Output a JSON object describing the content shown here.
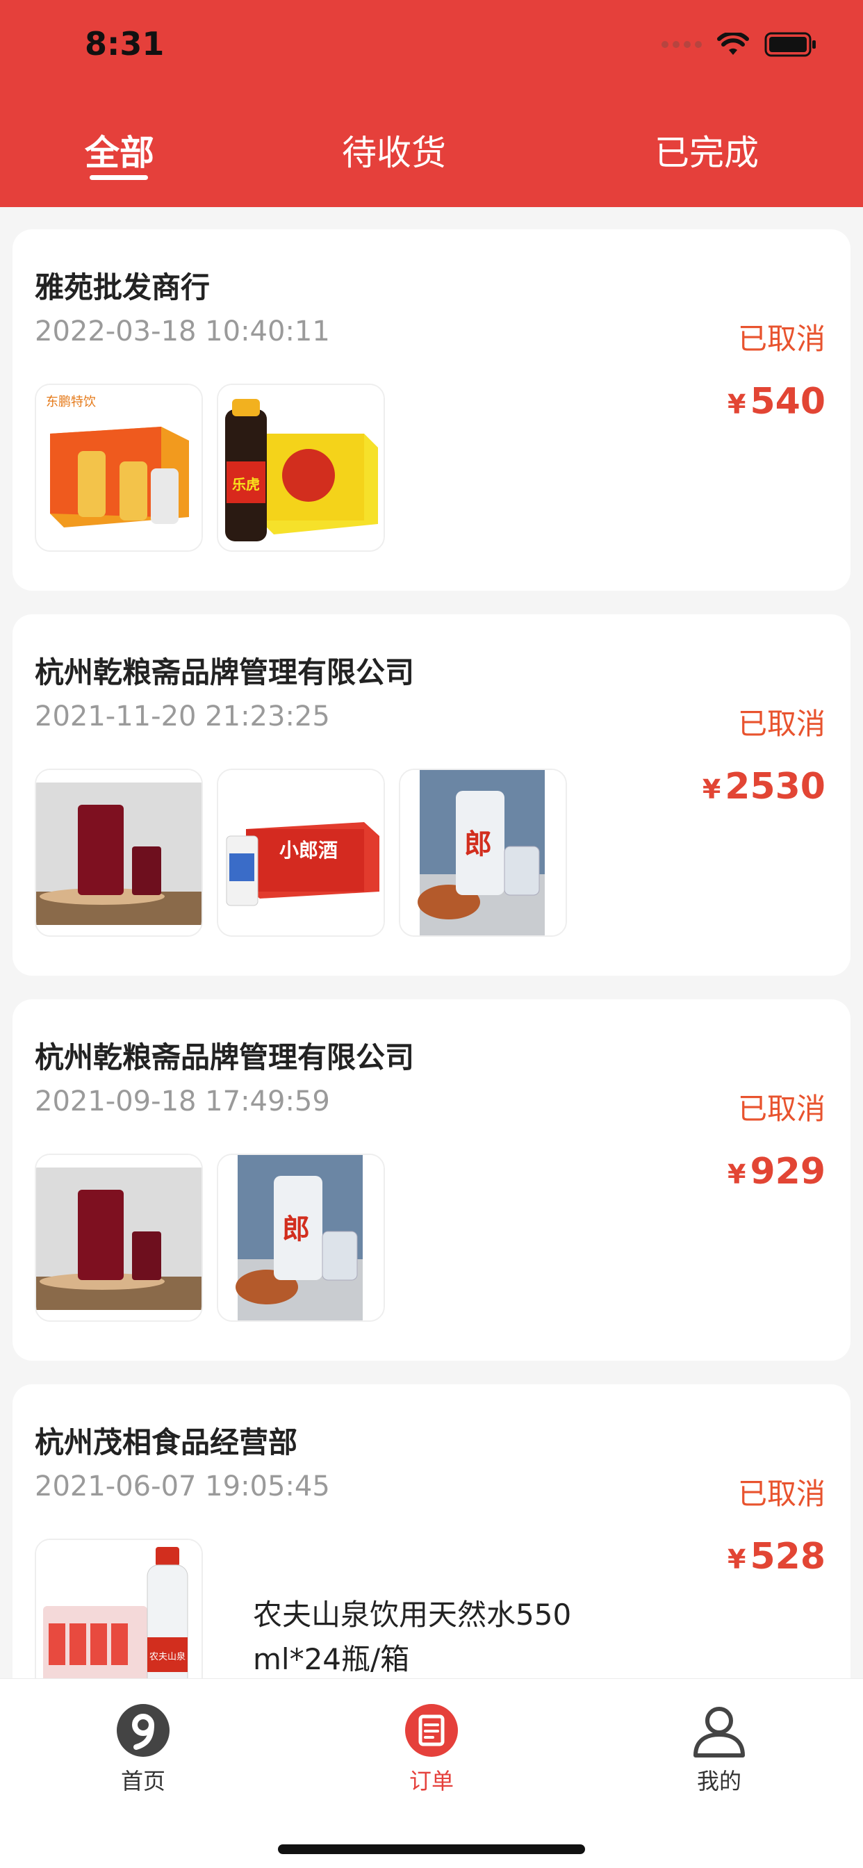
{
  "status_bar": {
    "time": "8:31"
  },
  "tabs": [
    {
      "label": "全部",
      "active": true
    },
    {
      "label": "待收货",
      "active": false
    },
    {
      "label": "已完成",
      "active": false
    }
  ],
  "orders": [
    {
      "shop": "雅苑批发商行",
      "time": "2022-03-18 10:40:11",
      "status": "已取消",
      "currency": "¥",
      "price": "540",
      "thumbnails": [
        "energy-drink-case",
        "letiger-drink-case"
      ]
    },
    {
      "shop": "杭州乾粮斋品牌管理有限公司",
      "time": "2021-11-20 21:23:25",
      "status": "已取消",
      "currency": "¥",
      "price": "2530",
      "thumbnails": [
        "red-drink-cups",
        "xiaolang-liquor-case",
        "lang-liquor-bottle"
      ]
    },
    {
      "shop": "杭州乾粮斋品牌管理有限公司",
      "time": "2021-09-18 17:49:59",
      "status": "已取消",
      "currency": "¥",
      "price": "929",
      "thumbnails": [
        "red-drink-cups",
        "lang-liquor-bottle"
      ]
    },
    {
      "shop": "杭州茂相食品经营部",
      "time": "2021-06-07 19:05:45",
      "status": "已取消",
      "currency": "¥",
      "price": "528",
      "thumbnails": [
        "water-bottle-pack"
      ],
      "item_name": "农夫山泉饮用天然水550ml*24瓶/箱"
    }
  ],
  "thumb_labels": {
    "xiaolang": "小郎酒",
    "lang": "郎",
    "brand": "东鹏特饮",
    "letiger": "乐虎",
    "water": "农夫山泉"
  },
  "bottom_nav": [
    {
      "label": "首页",
      "icon": "home-icon",
      "active": false
    },
    {
      "label": "订单",
      "icon": "order-icon",
      "active": true
    },
    {
      "label": "我的",
      "icon": "profile-icon",
      "active": false
    }
  ],
  "colors": {
    "accent": "#e5403b",
    "status": "#e8532e",
    "price": "#e24534"
  }
}
